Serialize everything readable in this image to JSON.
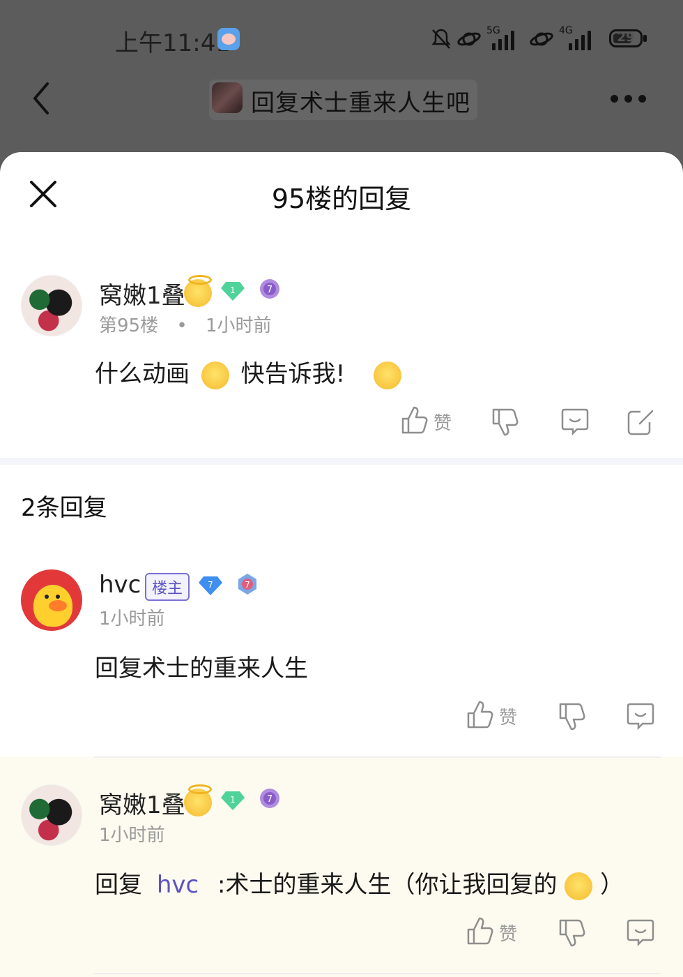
{
  "status_bar": {
    "time": "上午11:41",
    "network_1": "5G",
    "network_2": "4G",
    "battery": "29"
  },
  "nav": {
    "forum_title": "回复术士重来人生吧"
  },
  "sheet": {
    "title": "95楼的回复"
  },
  "main_post": {
    "username": "窝嫩1叠",
    "floor": "第95楼",
    "separator": "•",
    "time": "1小时前",
    "text": "什么动画",
    "text_after": "快告诉我!",
    "like_label": "赞"
  },
  "replies_header": "2条回复",
  "replies": [
    {
      "username": "hvc",
      "owner_tag": "楼主",
      "time": "1小时前",
      "text": "回复术士的重来人生",
      "like_label": "赞"
    },
    {
      "username": "窝嫩1叠",
      "time": "1小时前",
      "prefix": "回复",
      "mention": "hvc",
      "text": ":术士的重来人生（你让我回复的",
      "text_end": "）",
      "like_label": "赞"
    }
  ],
  "colors": {
    "accent": "#5b53c4",
    "overlay": "#5c5c5c",
    "highlight_bg": "#fdfbef",
    "muted_text": "#9a9a9a"
  }
}
